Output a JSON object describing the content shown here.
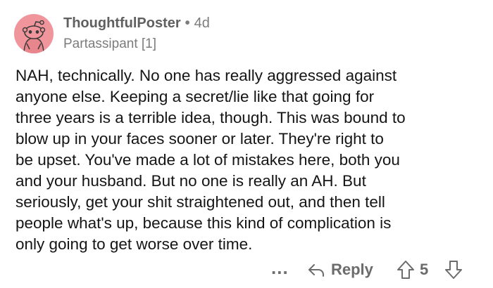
{
  "comment": {
    "username": "ThoughtfulPoster",
    "separator": "•",
    "age": "4d",
    "flair": "Partassipant [1]",
    "body": "NAH, technically. No one has really aggressed against\nanyone else. Keeping a secret/lie like that going for\nthree years is a terrible idea, though. This was bound to\nblow up in your faces sooner or later. They're right to\nbe upset. You've made a lot of mistakes here, both you\nand your husband. But no one is really an AH. But\nseriously, get your shit straightened out, and then tell\npeople what's up, because this kind of complication is\nonly going to get worse over time.",
    "avatar_color": "#f0959b"
  },
  "actions": {
    "more_label": "...",
    "reply_label": "Reply",
    "score": "5",
    "upvote_icon": "upvote-arrow-icon",
    "downvote_icon": "downvote-arrow-icon",
    "reply_icon": "reply-arrow-icon"
  }
}
